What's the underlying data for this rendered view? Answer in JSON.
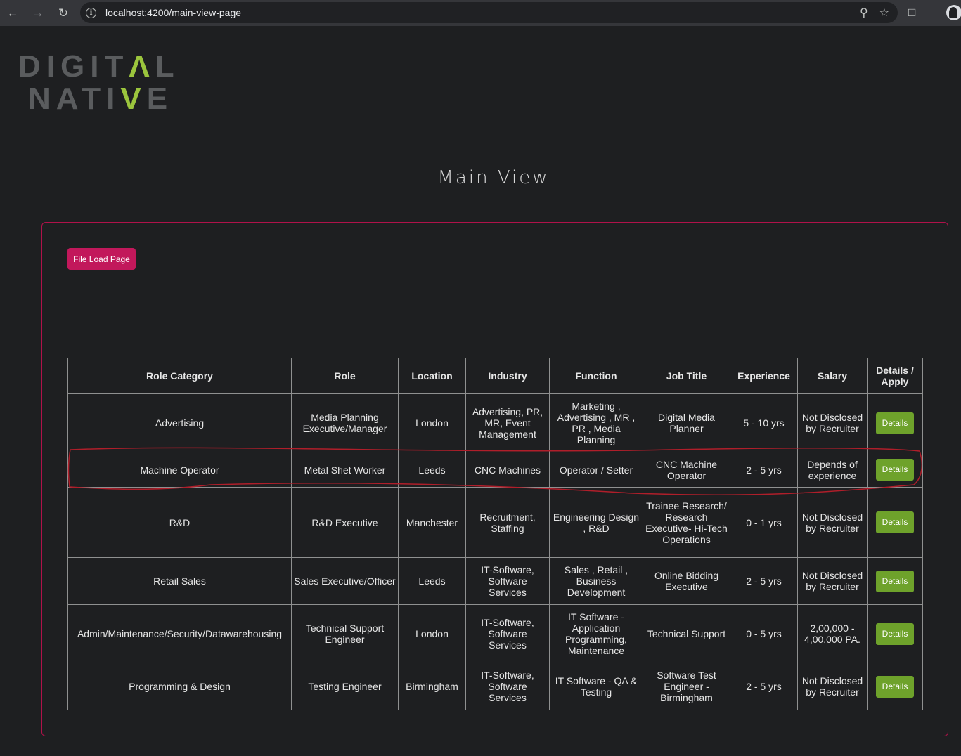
{
  "browser": {
    "url_host": "localhost",
    "url_rest": ":4200/main-view-page"
  },
  "logo": {
    "line1_a": "DIGIT",
    "line1_accent": "Λ",
    "line1_b": "L",
    "line2_a": "NATI",
    "line2_accent": "V",
    "line2_b": "E"
  },
  "page": {
    "title": "Main View",
    "file_load_button": "File Load Page"
  },
  "table": {
    "headers": [
      "Role Category",
      "Role",
      "Location",
      "Industry",
      "Function",
      "Job Title",
      "Experience",
      "Salary",
      "Details / Apply"
    ],
    "rows": [
      [
        "Advertising",
        "Media Planning Executive/Manager",
        "London",
        "Advertising, PR, MR, Event Management",
        "Marketing , Advertising , MR , PR , Media Planning",
        "Digital Media Planner",
        "5 - 10 yrs",
        "Not Disclosed by Recruiter",
        "Details"
      ],
      [
        "Machine Operator",
        "Metal Shet Worker",
        "Leeds",
        "CNC Machines",
        "Operator / Setter",
        "CNC Machine Operator",
        "2 - 5 yrs",
        "Depends of experience",
        "Details"
      ],
      [
        "R&D",
        "R&D Executive",
        "Manchester",
        "Recruitment, Staffing",
        "Engineering Design , R&D",
        "Trainee Research/ Research Executive- Hi-Tech Operations",
        "0 - 1 yrs",
        "Not Disclosed by Recruiter",
        "Details"
      ],
      [
        "Retail Sales",
        "Sales Executive/Officer",
        "Leeds",
        "IT-Software, Software Services",
        "Sales , Retail , Business Development",
        "Online Bidding Executive",
        "2 - 5 yrs",
        "Not Disclosed by Recruiter",
        "Details"
      ],
      [
        "Admin/Maintenance/Security/Datawarehousing",
        "Technical Support Engineer",
        "London",
        "IT-Software, Software Services",
        "IT Software - Application Programming, Maintenance",
        "Technical Support",
        "0 - 5 yrs",
        "2,00,000 - 4,00,000 PA.",
        "Details"
      ],
      [
        "Programming & Design",
        "Testing Engineer",
        "Birmingham",
        "IT-Software, Software Services",
        "IT Software - QA & Testing",
        "Software Test Engineer - Birmingham",
        "2 - 5 yrs",
        "Not Disclosed by Recruiter",
        "Details"
      ]
    ]
  },
  "colors": {
    "accent_pink": "#c2185b",
    "panel_border": "#b0124a",
    "details_green": "#6ea22b",
    "logo_green": "#9bc53d",
    "annotation_red": "#b01e2a"
  }
}
